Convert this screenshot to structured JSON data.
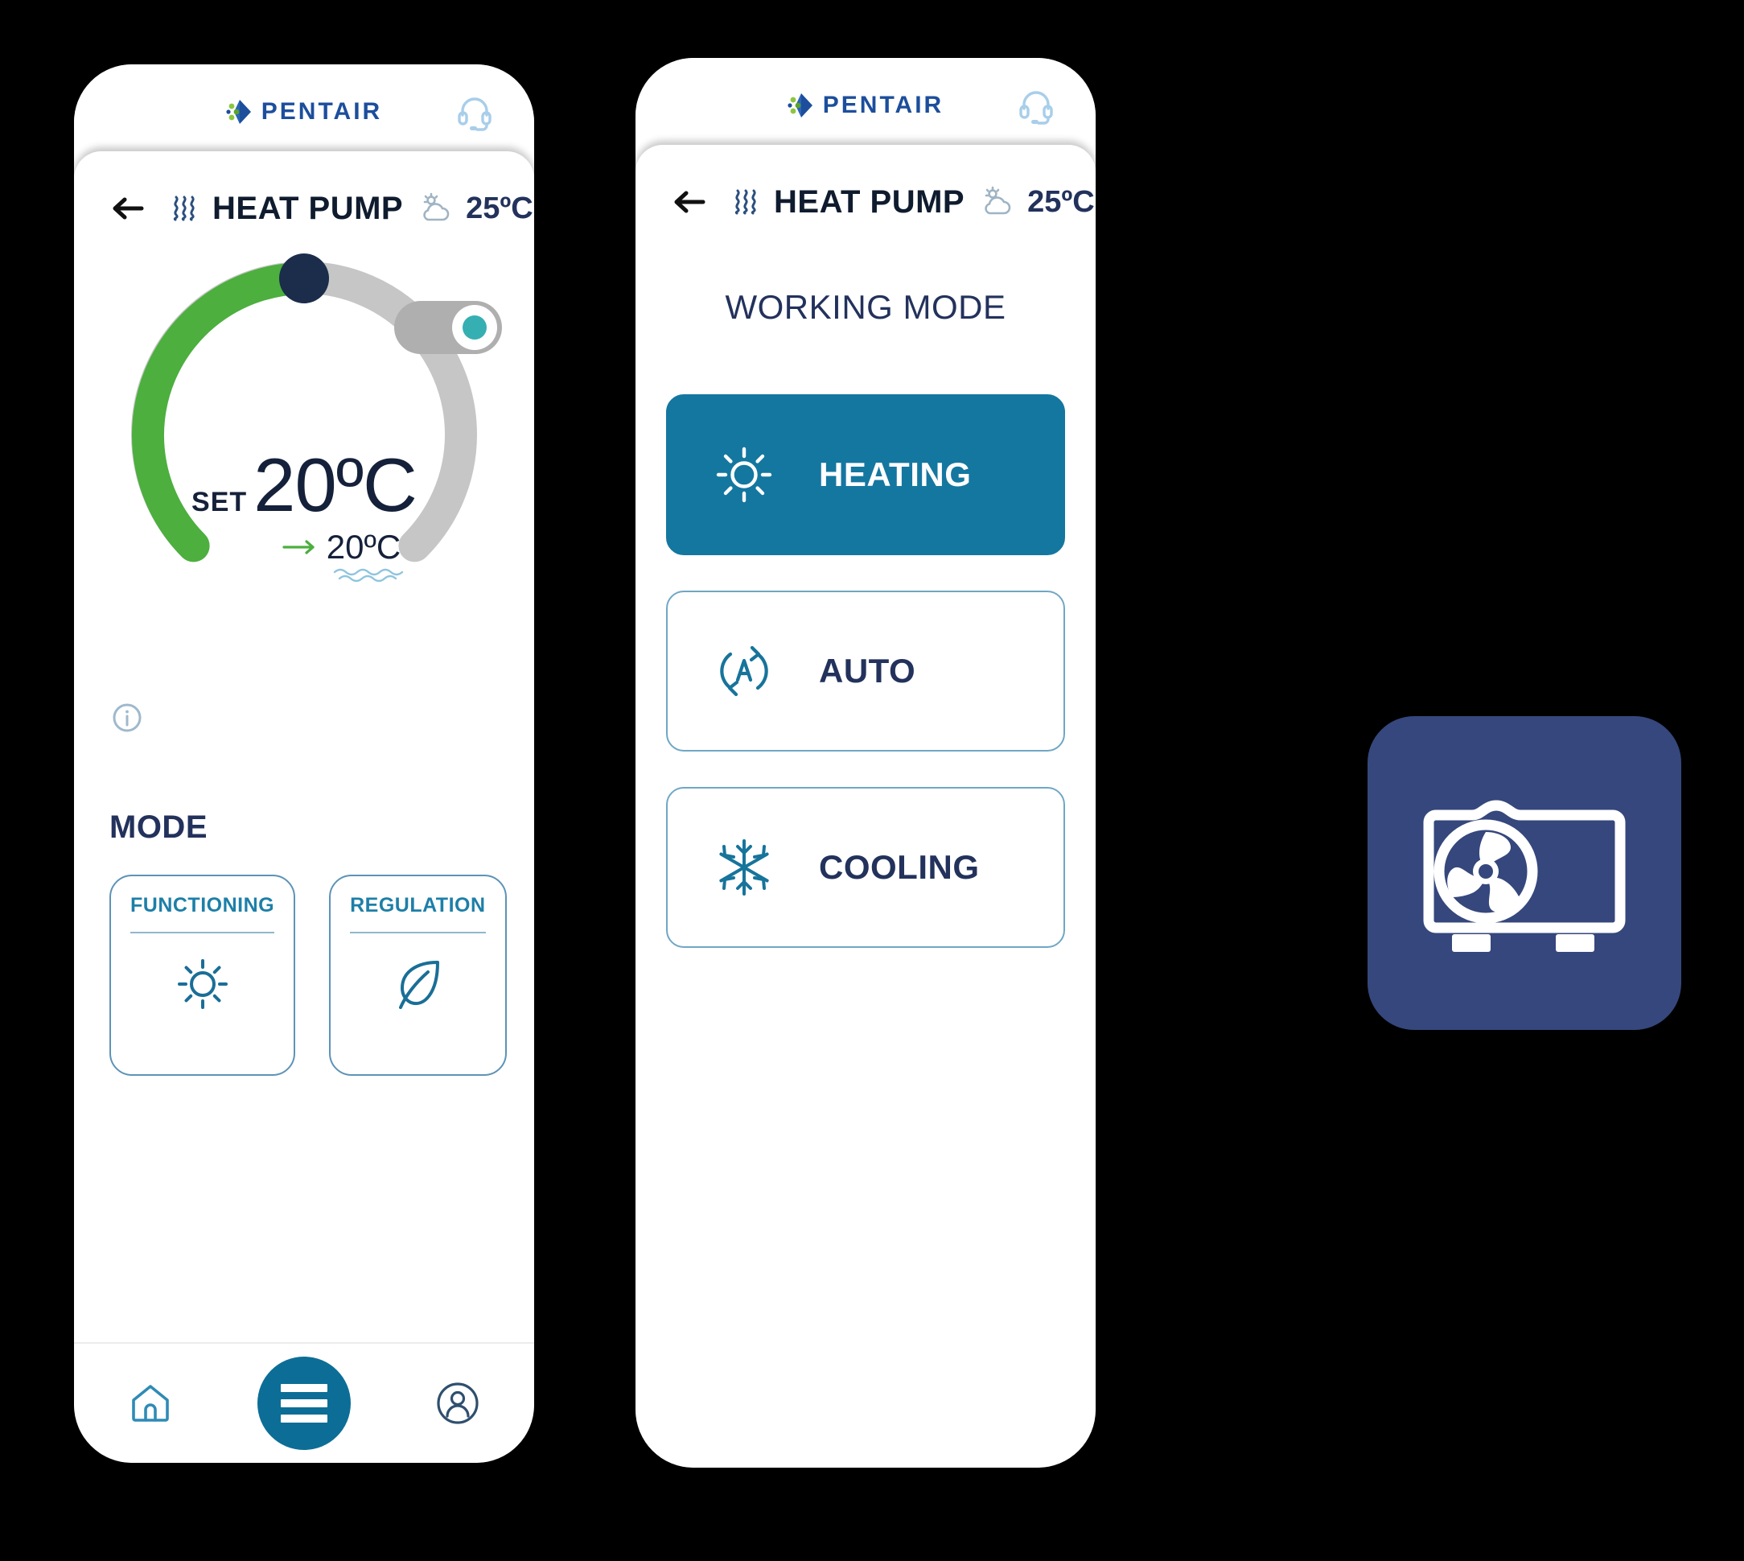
{
  "brand": {
    "name": "PENTAIR",
    "logo_icon": "pentair-diamond-logo",
    "support_icon": "headset-support-icon"
  },
  "screens": [
    {
      "id": "heat-pump-control",
      "header": {
        "back_icon": "back-arrow-icon",
        "title_icon": "heat-waves-icon",
        "title": "HEAT PUMP",
        "weather_icon": "partly-cloudy-icon",
        "weather_temp": "25ºC"
      },
      "dial": {
        "set_label": "SET",
        "set_value": "20ºC",
        "actual_arrow_icon": "arrow-right-icon",
        "actual_value": "20ºC",
        "water_icon": "water-waves-icon",
        "info_icon": "info-circle-icon",
        "arc_progress_percent": 50,
        "arc_color": "#4CAF3E",
        "arc_track_color": "#C6C6C6",
        "handle_color": "#1B2D4A",
        "power_toggle": {
          "state": "on",
          "track_color": "#AFAFAF",
          "knob_color": "#FFFFFF",
          "dot_color": "#36AFB3"
        }
      },
      "mode": {
        "heading": "MODE",
        "cards": [
          {
            "label": "FUNCTIONING",
            "icon": "sun-icon"
          },
          {
            "label": "REGULATION",
            "icon": "leaf-icon"
          }
        ]
      },
      "bottom_nav": {
        "home_icon": "home-icon",
        "menu_icon": "hamburger-menu-icon",
        "profile_icon": "user-profile-icon",
        "fab_color": "#0C6E96"
      }
    },
    {
      "id": "working-mode",
      "header": {
        "back_icon": "back-arrow-icon",
        "title_icon": "heat-waves-icon",
        "title": "HEAT PUMP",
        "weather_icon": "partly-cloudy-icon",
        "weather_temp": "25ºC"
      },
      "working_mode": {
        "title": "WORKING MODE",
        "selected_color": "#1477A0",
        "options": [
          {
            "label": "HEATING",
            "icon": "sun-icon",
            "selected": true
          },
          {
            "label": "AUTO",
            "icon": "auto-cycle-icon",
            "selected": false
          },
          {
            "label": "COOLING",
            "icon": "snowflake-icon",
            "selected": false
          }
        ]
      }
    }
  ],
  "device_badge": {
    "icon": "heat-pump-unit-fan-icon",
    "background_color": "#35477C"
  }
}
